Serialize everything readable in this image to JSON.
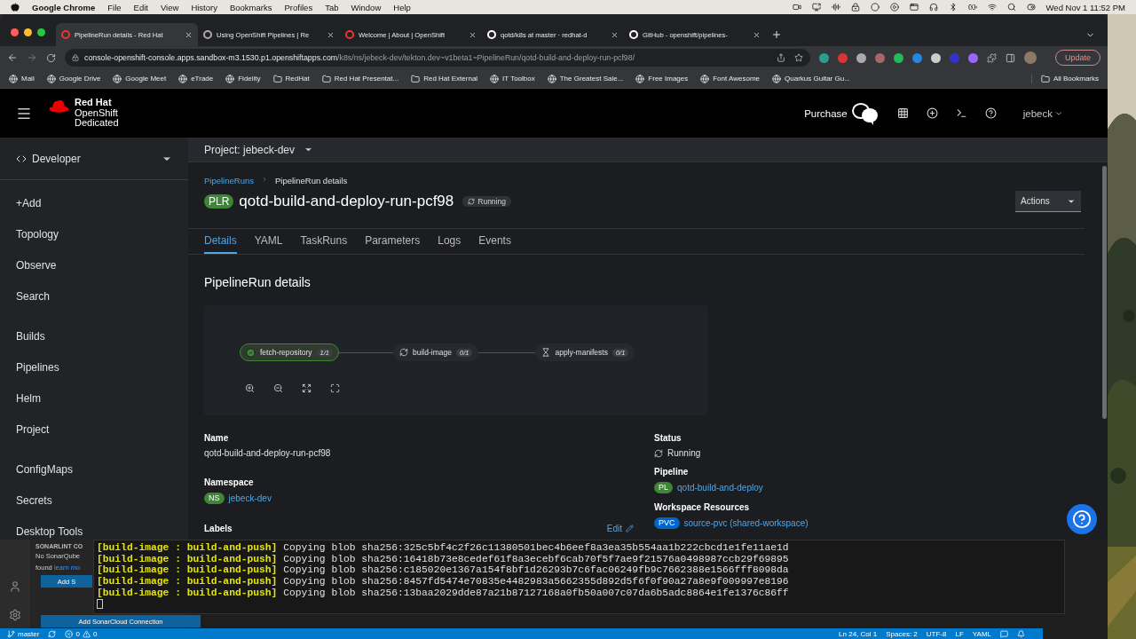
{
  "menu_bar": {
    "app": "Google Chrome",
    "menus": [
      "File",
      "Edit",
      "View",
      "History",
      "Bookmarks",
      "Profiles",
      "Tab",
      "Window",
      "Help"
    ],
    "clock": "Wed Nov 1  11:52 PM"
  },
  "browser": {
    "tabs": [
      {
        "title": "PipelineRun details - Red Hat",
        "selected": true
      },
      {
        "title": "Using OpenShift Pipelines | Re",
        "selected": false
      },
      {
        "title": "Welcome | About | OpenShift",
        "selected": false
      },
      {
        "title": "qotd/k8s at master · redhat-d",
        "selected": false
      },
      {
        "title": "GitHub - openshift/pipelines-",
        "selected": false
      }
    ],
    "address": {
      "host": "console-openshift-console.apps.sandbox-m3.1530.p1.openshiftapps.com",
      "path": "/k8s/ns/jebeck-dev/tekton.dev~v1beta1~PipelineRun/qotd-build-and-deploy-run-pcf98/"
    },
    "update_button": "Update",
    "bookmarks": [
      {
        "label": "Mail",
        "kind": "site"
      },
      {
        "label": "Google Drive",
        "kind": "site"
      },
      {
        "label": "Google Meet",
        "kind": "site"
      },
      {
        "label": "eTrade",
        "kind": "site"
      },
      {
        "label": "Fidelity",
        "kind": "site"
      },
      {
        "label": "RedHat",
        "kind": "folder"
      },
      {
        "label": "Red Hat Presentat...",
        "kind": "folder"
      },
      {
        "label": "Red Hat External",
        "kind": "folder"
      },
      {
        "label": "IT Toolbox",
        "kind": "site"
      },
      {
        "label": "The Greatest Sale...",
        "kind": "site"
      },
      {
        "label": "Free Images",
        "kind": "site"
      },
      {
        "label": "Font Awesome",
        "kind": "site"
      },
      {
        "label": "Quarkus Guitar Gu...",
        "kind": "site"
      }
    ],
    "all_bookmarks": "All Bookmarks"
  },
  "console": {
    "logo": {
      "brand": "Red Hat",
      "product": "OpenShift",
      "edition": "Dedicated"
    },
    "purchase": "Purchase",
    "user": "jebeck",
    "perspective": "Developer",
    "nav_sections": [
      {
        "items": [
          "+Add",
          "Topology",
          "Observe",
          "Search"
        ]
      },
      {
        "items": [
          "Builds",
          "Pipelines",
          "Helm",
          "Project"
        ]
      },
      {
        "items": [
          "ConfigMaps",
          "Secrets",
          "Desktop Tools"
        ]
      }
    ],
    "project": "Project: jebeck-dev",
    "breadcrumbs": [
      "PipelineRuns",
      "PipelineRun details"
    ],
    "title_badge": "PLR",
    "title": "qotd-build-and-deploy-run-pcf98",
    "status": "Running",
    "actions": "Actions",
    "tabs": [
      {
        "label": "Details",
        "selected": true
      },
      {
        "label": "YAML",
        "selected": false
      },
      {
        "label": "TaskRuns",
        "selected": false
      },
      {
        "label": "Parameters",
        "selected": false
      },
      {
        "label": "Logs",
        "selected": false
      },
      {
        "label": "Events",
        "selected": false
      }
    ],
    "section_title": "PipelineRun details",
    "pipeline_nodes": [
      {
        "name": "fetch-repository",
        "kind": "succeeded",
        "count": "1/1"
      },
      {
        "name": "build-image",
        "kind": "running",
        "count": "0/1"
      },
      {
        "name": "apply-manifests",
        "kind": "pending",
        "count": "0/1"
      }
    ],
    "details_left": [
      {
        "kind": "text",
        "label": "Name",
        "value": "qotd-build-and-deploy-run-pcf98"
      },
      {
        "kind": "resource",
        "label": "Namespace",
        "badge": "NS",
        "color": "#3e8635",
        "value": "jebeck-dev"
      },
      {
        "kind": "labels",
        "label": "Labels",
        "edit": "Edit"
      }
    ],
    "details_right": [
      {
        "kind": "status",
        "label": "Status",
        "value": "Running"
      },
      {
        "kind": "resource",
        "label": "Pipeline",
        "badge": "PL",
        "color": "#3e8635",
        "value": "qotd-build-and-deploy"
      },
      {
        "kind": "resource",
        "label": "Workspace Resources",
        "badge": "PVC",
        "color": "#0066cc",
        "value": "source-pvc (shared-workspace)"
      }
    ]
  },
  "editor": {
    "sidebar": {
      "header": "SONARLINT CO",
      "message": "No SonarQube",
      "message_end": "found",
      "link": "learn mo",
      "button": "Add S",
      "button_wide": "Add SonarCloud Connection"
    },
    "terminal": [
      {
        "prefix": "[build-image : build-and-push]",
        "text": "Copying blob sha256:325c5bf4c2f26c11380501bec4b6eef8a3ea35b554aa1b222cbcd1e1fe11ae1d"
      },
      {
        "prefix": "[build-image : build-and-push]",
        "text": "Copying blob sha256:16418b73e8cedef61f8a3ecebf6cab70f5f7ae9f21576a0498987ccb29f69895"
      },
      {
        "prefix": "[build-image : build-and-push]",
        "text": "Copying blob sha256:c185020e1367a154f8bf1d26293b7c6fac06249fb9c7662388e1566fff8098da"
      },
      {
        "prefix": "[build-image : build-and-push]",
        "text": "Copying blob sha256:8457fd5474e70835e4482983a5662355d892d5f6f0f90a27a8e9f009997e8196"
      },
      {
        "prefix": "[build-image : build-and-push]",
        "text": "Copying blob sha256:13baa2029dde87a21b87127168a0fb50a007c07da6b5adc8864e1fe1376c86ff"
      }
    ],
    "status_bar": {
      "branch": "master",
      "errors": "0",
      "warnings": "0",
      "items": [
        "Ln 24, Col 1",
        "Spaces: 2",
        "UTF-8",
        "LF",
        "YAML"
      ]
    }
  }
}
